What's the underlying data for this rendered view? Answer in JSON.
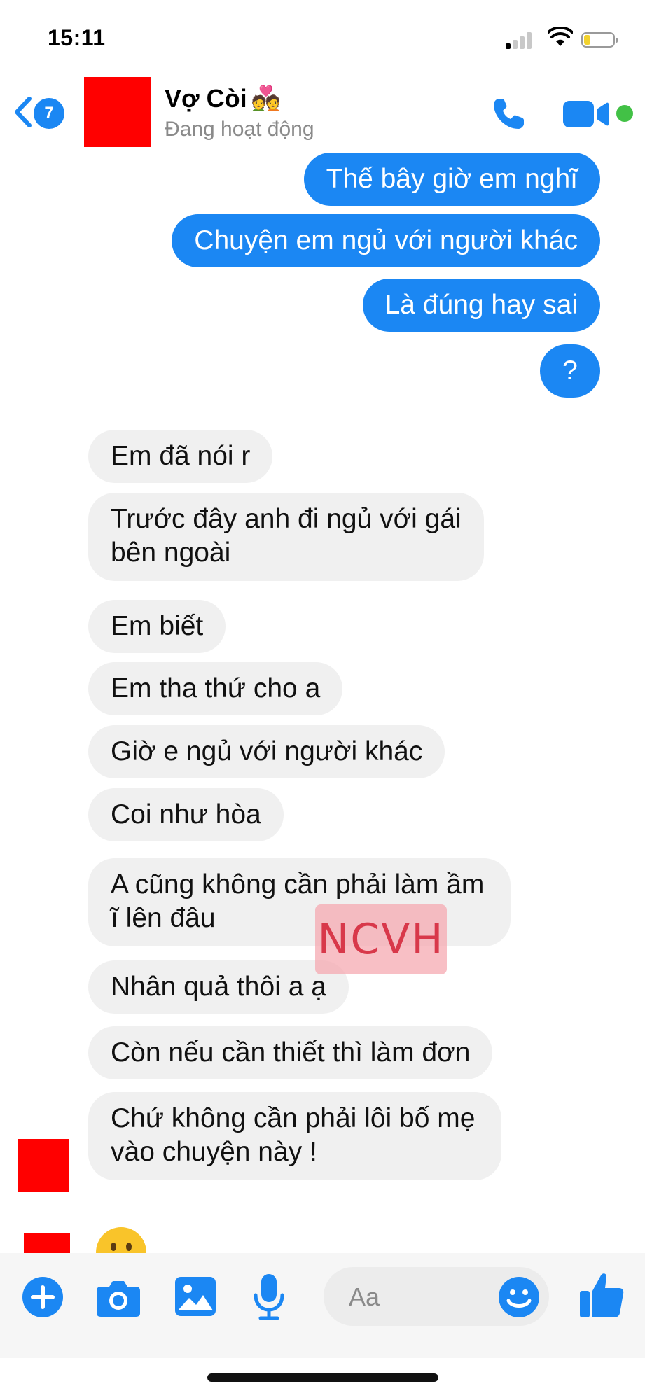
{
  "status_bar": {
    "time": "15:11"
  },
  "header": {
    "unread_count": "7",
    "contact_name": "Vợ Còi",
    "name_emoji": "💑",
    "activity_status": "Đang hoạt động"
  },
  "messages_sent": [
    "Thế bây giờ em nghĩ",
    "Chuyện em ngủ với người khác",
    "Là đúng hay sai",
    "?"
  ],
  "messages_received": [
    "Em đã nói r",
    "Trước đây anh đi ngủ với gái",
    "bên ngoài",
    "Em biết",
    "Em tha thứ cho a",
    "Giờ e ngủ với người khác",
    "Coi như hòa",
    "A cũng không cần phải làm ầm",
    "ĩ lên đâu",
    "Nhân quả thôi a ạ",
    "Còn nếu cần thiết thì làm đơn",
    "Chứ không cần phải lôi bố mẹ",
    "vào chuyện này !"
  ],
  "last_emoji": "😶",
  "watermark": "NCVH",
  "composer": {
    "placeholder": "Aa"
  },
  "colors": {
    "accent": "#1b87f3",
    "received_bubble": "#f0f0f0",
    "online": "#42c146",
    "redaction": "#ff0000"
  },
  "icons": [
    "back-chevron-icon",
    "phone-icon",
    "video-camera-icon",
    "plus-icon",
    "camera-icon",
    "image-icon",
    "microphone-icon",
    "emoji-icon",
    "thumbs-up-icon"
  ]
}
